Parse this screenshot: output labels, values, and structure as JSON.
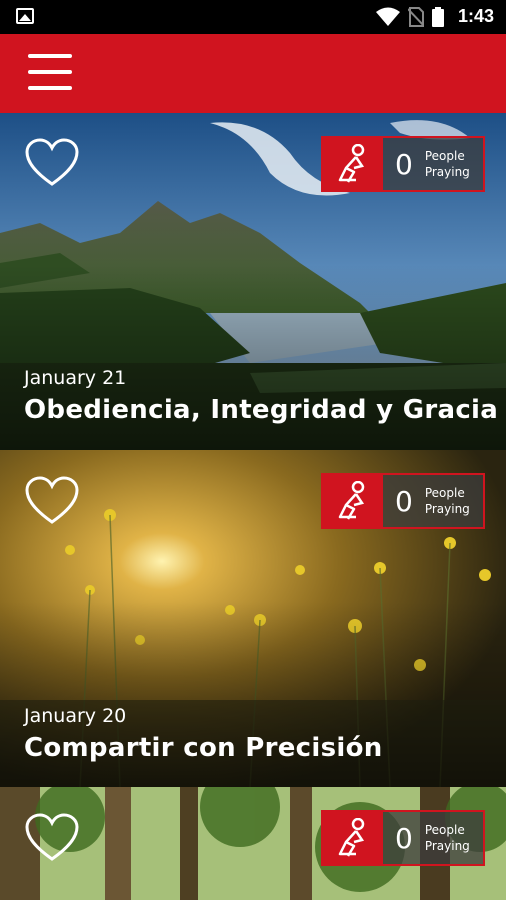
{
  "status_bar": {
    "time": "1:43"
  },
  "cards": [
    {
      "date": "January 21",
      "title": "Obediencia, Integridad y Gracia",
      "count": "0",
      "label_line1": "People",
      "label_line2": "Praying"
    },
    {
      "date": "January 20",
      "title": "Compartir con Precisión",
      "count": "0",
      "label_line1": "People",
      "label_line2": "Praying"
    },
    {
      "date": "",
      "title": "",
      "count": "0",
      "label_line1": "People",
      "label_line2": "Praying"
    }
  ],
  "colors": {
    "accent": "#d0141f",
    "statusbar": "#000000"
  },
  "icons": {
    "menu": "hamburger-icon",
    "favorite": "heart-outline-icon",
    "pray": "praying-person-icon"
  }
}
